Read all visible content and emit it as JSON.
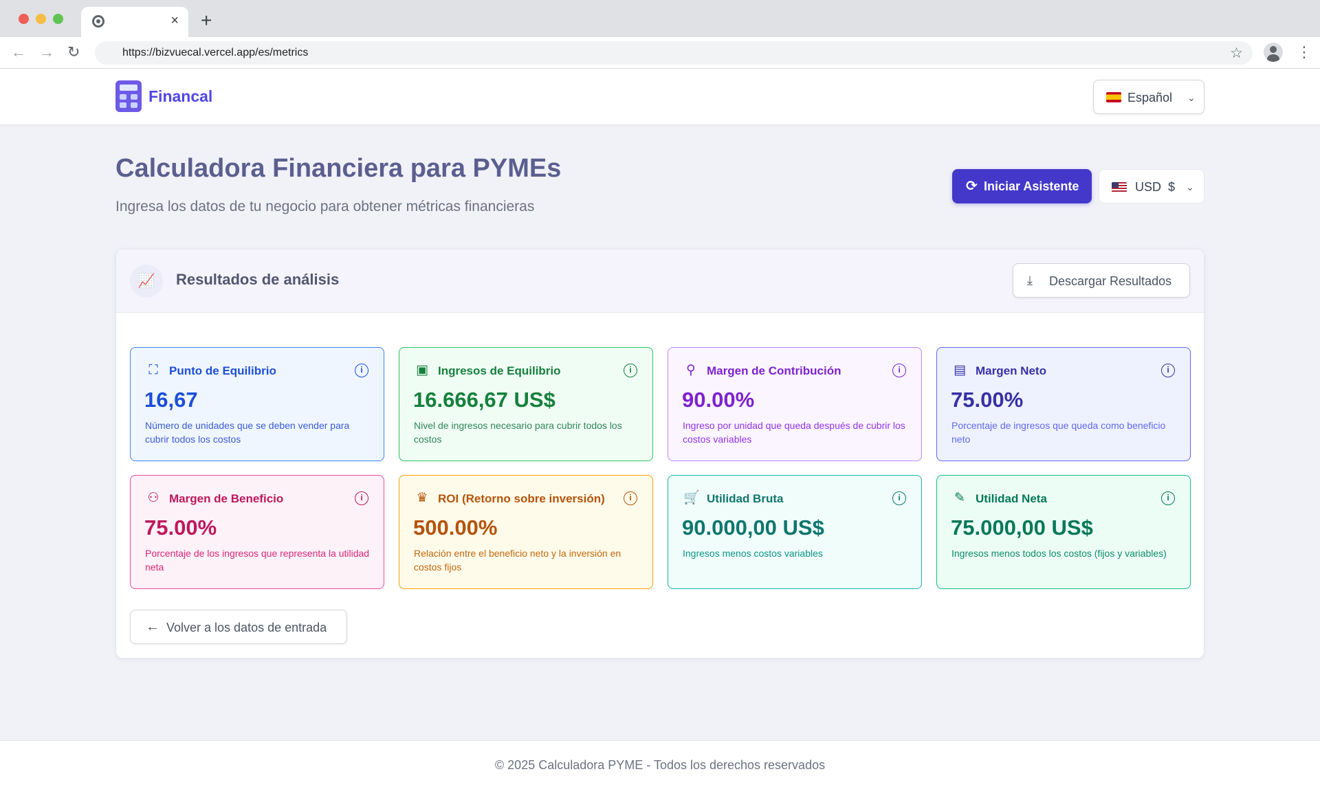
{
  "browser": {
    "url": "https://bizvuecal.vercel.app/es/metrics",
    "tab_close": "×",
    "new_tab": "+"
  },
  "header": {
    "brand": "Financal",
    "language": "Español"
  },
  "page": {
    "title": "Calculadora Financiera para PYMEs",
    "subtitle": "Ingresa los datos de tu negocio para obtener métricas financieras",
    "wizard_button": "Iniciar Asistente",
    "currency": "USD  $"
  },
  "results": {
    "title": "Resultados de análisis",
    "download_button": "Descargar Resultados",
    "back_button": "Volver a los datos de entrada",
    "metrics": [
      {
        "title": "Punto de Equilibrio",
        "value": "16,67",
        "description": "Número de unidades que se deben vender para cubrir todos los costos",
        "icon": "chart-icon",
        "color": "#1d4ed8"
      },
      {
        "title": "Ingresos de Equilibrio",
        "value": "16.666,67 US$",
        "description": "Nivel de ingresos necesario para cubrir todos los costos",
        "icon": "money-icon",
        "color": "#15803d"
      },
      {
        "title": "Margen de Contribución",
        "value": "90.00%",
        "description": "Ingreso por unidad que queda después de cubrir los costos variables",
        "icon": "piggy-bank-icon",
        "color": "#7e22ce"
      },
      {
        "title": "Margen Neto",
        "value": "75.00%",
        "description": "Porcentaje de ingresos que queda como beneficio neto",
        "icon": "scroll-icon",
        "color": "#3730a3"
      },
      {
        "title": "Margen de Beneficio",
        "value": "75.00%",
        "description": "Porcentaje de los ingresos que representa la utilidad neta",
        "icon": "users-icon",
        "color": "#be185d"
      },
      {
        "title": "ROI (Retorno sobre inversión)",
        "value": "500.00%",
        "description": "Relación entre el beneficio neto y la inversión en costos fijos",
        "icon": "crown-icon",
        "color": "#b45309"
      },
      {
        "title": "Utilidad Bruta",
        "value": "90.000,00 US$",
        "description": "Ingresos menos costos variables",
        "icon": "cart-icon",
        "color": "#0f766e"
      },
      {
        "title": "Utilidad Neta",
        "value": "75.000,00 US$",
        "description": "Ingresos menos todos los costos (fijos y variables)",
        "icon": "pen-tool-icon",
        "color": "#047857"
      }
    ]
  },
  "footer": {
    "text": "© 2025 Calculadora PYME - Todos los derechos reservados"
  }
}
